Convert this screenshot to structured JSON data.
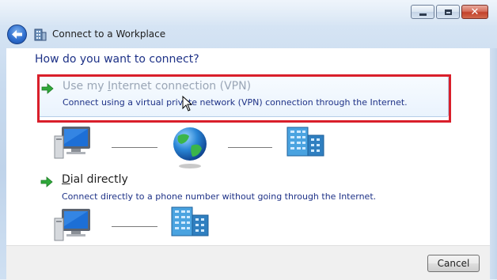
{
  "window": {
    "title": "Connect to a Workplace",
    "caption_buttons": {
      "minimize_icon": "minimize-icon",
      "maximize_icon": "maximize-icon",
      "close_glyph": "✕"
    }
  },
  "navigation": {
    "back_icon": "back-arrow-icon"
  },
  "main": {
    "heading": "How do you want to connect?",
    "options": [
      {
        "title_prefix": "Use my ",
        "title_accel": "I",
        "title_suffix": "nternet connection (VPN)",
        "description": "Connect using a virtual private network (VPN) connection through the Internet.",
        "icon": "green-arrow-icon",
        "diagram": [
          "computer-icon",
          "globe-icon",
          "server-icon"
        ]
      },
      {
        "title_prefix": "",
        "title_accel": "D",
        "title_suffix": "ial directly",
        "description": "Connect directly to a phone number without going through the Internet.",
        "icon": "green-arrow-icon",
        "diagram": [
          "computer-icon",
          "server-icon"
        ]
      }
    ]
  },
  "footer": {
    "cancel_label": "Cancel"
  },
  "colors": {
    "heading": "#1e3287",
    "description": "#1e3287",
    "highlight_box": "#d91f2b",
    "hover_title": "#9aa6b6"
  }
}
